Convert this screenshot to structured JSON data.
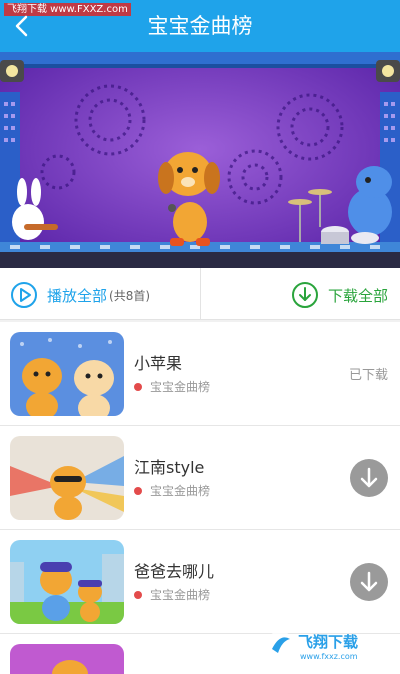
{
  "watermark": "飞翔下载 www.FXXZ.com",
  "header": {
    "title": "宝宝金曲榜",
    "back_icon": "chevron-left-icon"
  },
  "actions": {
    "play_all_label": "播放全部",
    "play_all_count": "(共8首)",
    "download_all_label": "下载全部"
  },
  "songs": [
    {
      "title": "小苹果",
      "album": "宝宝金曲榜",
      "status": "已下载"
    },
    {
      "title": "江南style",
      "album": "宝宝金曲榜"
    },
    {
      "title": "爸爸去哪儿",
      "album": "宝宝金曲榜"
    }
  ],
  "colors": {
    "header": "#1fa3ea",
    "accent_blue": "#1fa3ea",
    "accent_green": "#2aa43c",
    "dot": "#e34b4b"
  },
  "logo_watermark": {
    "text": "飞翔下载",
    "url": "www.fxxz.com"
  }
}
